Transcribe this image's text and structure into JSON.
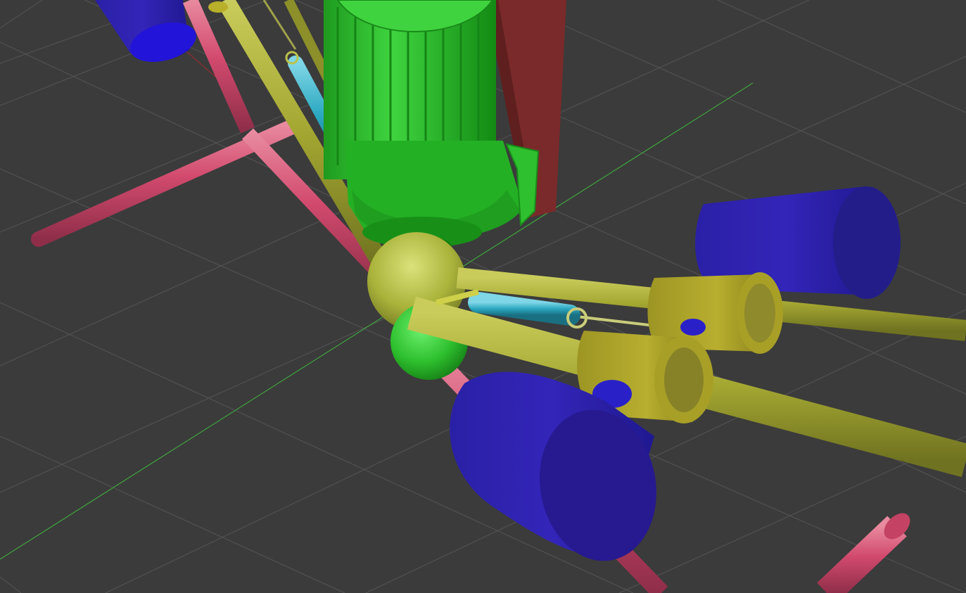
{
  "scene": {
    "kind": "3d-viewport",
    "background_color": "#3b3b3b",
    "grid_color": "#555555",
    "axis_color": "#3fa33f",
    "colors": {
      "pipe": "#d24a6e",
      "strut": "#a3a631",
      "motor": "#2ec02e",
      "wall": "#7a2a2a",
      "weight": "#2b1fb0",
      "spring": "#2aa7c0",
      "joint": "#b9c24a",
      "collar": "#b6ad2e"
    }
  }
}
